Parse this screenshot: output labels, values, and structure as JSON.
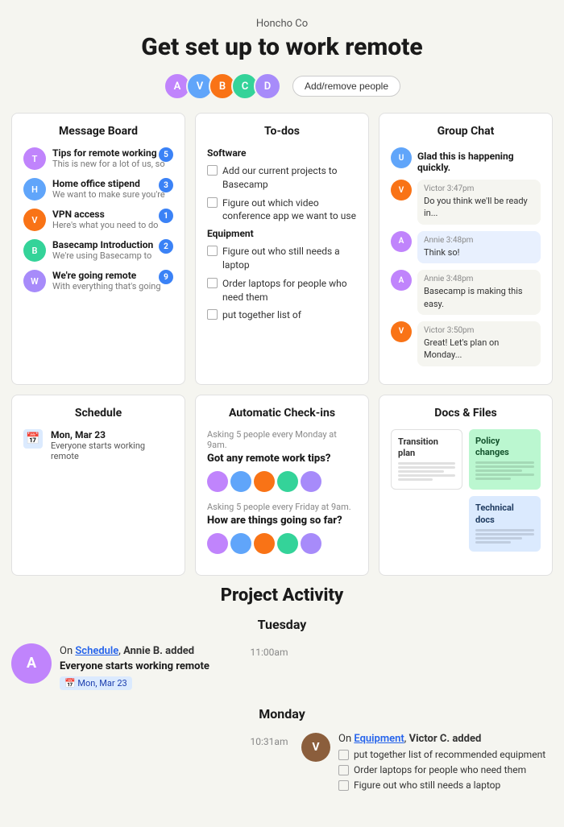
{
  "header": {
    "company": "Honcho Co",
    "title": "Get set up to work remote",
    "add_remove_label": "Add/remove people",
    "avatars": [
      {
        "color": "#c084fc",
        "initials": "A"
      },
      {
        "color": "#60a5fa",
        "initials": "V"
      },
      {
        "color": "#f97316",
        "initials": "B"
      },
      {
        "color": "#34d399",
        "initials": "C"
      },
      {
        "color": "#a78bfa",
        "initials": "D"
      }
    ]
  },
  "message_board": {
    "title": "Message Board",
    "items": [
      {
        "title": "Tips for remote working",
        "preview": "This is new for a lot of us, so",
        "badge": "5",
        "color": "#c084fc"
      },
      {
        "title": "Home office stipend",
        "preview": "We want to make sure you're",
        "badge": "3",
        "color": "#60a5fa"
      },
      {
        "title": "VPN access",
        "preview": "Here's what you need to do",
        "badge": "1",
        "color": "#f97316"
      },
      {
        "title": "Basecamp Introduction",
        "preview": "We're using Basecamp to",
        "badge": "2",
        "color": "#34d399"
      },
      {
        "title": "We're going remote",
        "preview": "With everything that's going",
        "badge": "9",
        "color": "#a78bfa"
      }
    ]
  },
  "todos": {
    "title": "To-dos",
    "sections": [
      {
        "label": "Software",
        "items": [
          "Add our current projects to Basecamp",
          "Figure out which video conference app we want to use"
        ]
      },
      {
        "label": "Equipment",
        "items": [
          "Figure out who still needs a laptop",
          "Order laptops for people who need them",
          "put together list of"
        ]
      }
    ]
  },
  "group_chat": {
    "title": "Group Chat",
    "messages": [
      {
        "sender": null,
        "time": null,
        "text": "Glad this is happening quickly.",
        "plain": true,
        "color": "#60a5fa"
      },
      {
        "sender": "Victor",
        "time": "3:47pm",
        "text": "Do you think we'll be ready in...",
        "plain": false,
        "color": "#f97316"
      },
      {
        "sender": "Annie",
        "time": "3:48pm",
        "text": "Think so!",
        "plain": false,
        "highlighted": true,
        "color": "#c084fc"
      },
      {
        "sender": "Annie",
        "time": "3:48pm",
        "text": "Basecamp is making this easy.",
        "plain": false,
        "color": "#c084fc"
      },
      {
        "sender": "Victor",
        "time": "3:50pm",
        "text": "Great! Let's plan on Monday...",
        "plain": false,
        "color": "#f97316"
      }
    ]
  },
  "schedule": {
    "title": "Schedule",
    "event_date": "Mon, Mar 23",
    "event_desc": "Everyone starts working remote"
  },
  "checkins": {
    "title": "Automatic Check-ins",
    "items": [
      {
        "asking": "Asking 5 people every Monday at 9am.",
        "question": "Got any remote work tips?",
        "avatars": [
          {
            "color": "#c084fc"
          },
          {
            "color": "#60a5fa"
          },
          {
            "color": "#f97316"
          },
          {
            "color": "#34d399"
          },
          {
            "color": "#a78bfa"
          }
        ]
      },
      {
        "asking": "Asking 5 people every Friday at 9am.",
        "question": "How are things going so far?",
        "avatars": [
          {
            "color": "#c084fc"
          },
          {
            "color": "#60a5fa"
          },
          {
            "color": "#f97316"
          },
          {
            "color": "#34d399"
          },
          {
            "color": "#a78bfa"
          }
        ]
      }
    ]
  },
  "docs": {
    "title": "Docs & Files",
    "items": [
      {
        "label": "Transition plan",
        "type": "white"
      },
      {
        "label": "Policy changes",
        "type": "green"
      },
      {
        "label": "Technical docs",
        "type": "blue"
      }
    ]
  },
  "activity": {
    "title": "Project Activity",
    "days": [
      {
        "day": "Tuesday",
        "events": [
          {
            "side": "left",
            "time": "11:00am",
            "avatar_color": "#c084fc",
            "initials": "A",
            "section_link": "Schedule",
            "person": "Annie B.",
            "action": "added",
            "item_text": "Everyone starts working remote",
            "date_badge": "Mon, Mar 23",
            "show_right": false
          }
        ]
      },
      {
        "day": "Monday",
        "events": [
          {
            "side": "right",
            "time": "10:31am",
            "avatar_color": "#8b5e3c",
            "initials": "V",
            "section_link": "Equipment",
            "person": "Victor C.",
            "action": "added",
            "todos": [
              "put together list of recommended equipment",
              "Order laptops for people who need them",
              "Figure out who still needs a laptop"
            ],
            "show_right": true
          }
        ]
      }
    ]
  }
}
